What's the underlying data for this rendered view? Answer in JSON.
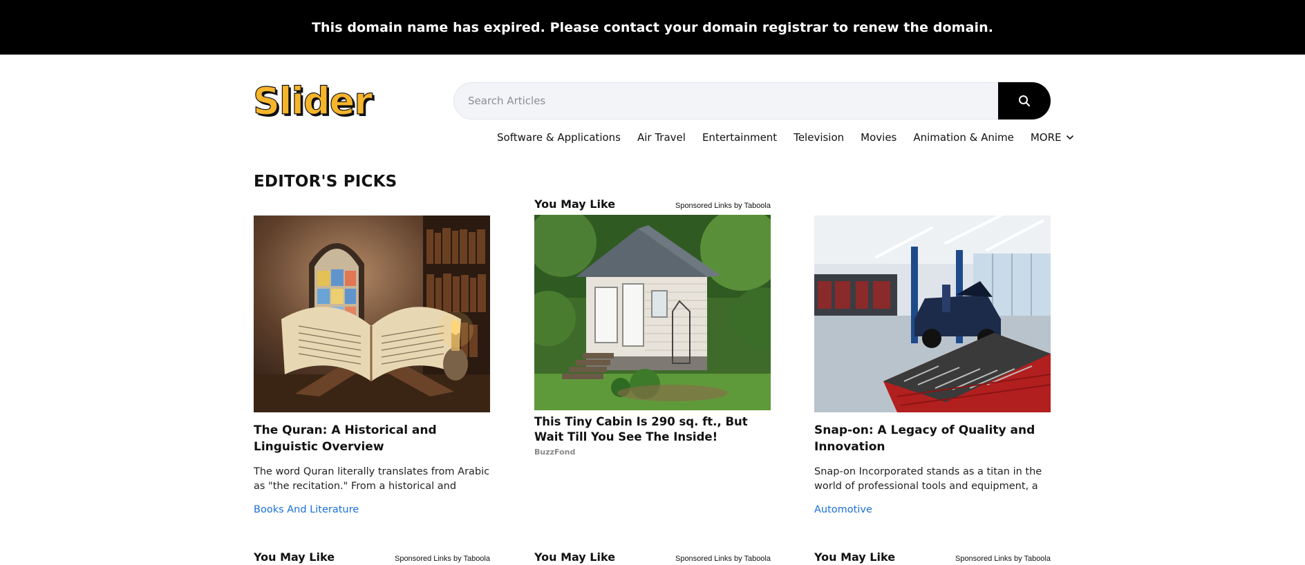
{
  "banner": {
    "text": "This domain name has expired. Please contact your domain registrar to renew the domain."
  },
  "logo": {
    "text": "Slider",
    "color": "#f7b52c"
  },
  "search": {
    "placeholder": "Search Articles",
    "value": "",
    "icon": "search-icon"
  },
  "nav": {
    "items": [
      "Software & Applications",
      "Air Travel",
      "Entertainment",
      "Television",
      "Movies",
      "Animation & Anime"
    ],
    "more_label": "MORE"
  },
  "editors_picks": {
    "heading": "EDITOR'S PICKS"
  },
  "cards": [
    {
      "title": "The Quran: A Historical and Linguistic Overview",
      "description": "The word Quran literally translates from Arabic as \"the recitation.\" From a historical and linguisti...",
      "category": "Books And Literature"
    },
    {
      "title": "Snap-on: A Legacy of Quality and Innovation",
      "description": "Snap-on Incorporated stands as a titan in the world of professional tools and equipment, a name syno...",
      "category": "Automotive"
    }
  ],
  "sponsored": {
    "heading": "You May Like",
    "attribution": "Sponsored Links by Taboola",
    "ad": {
      "title": "This Tiny Cabin Is 290 sq. ft., But Wait Till You See The Inside!",
      "source": "BuzzFond"
    }
  },
  "colors": {
    "link": "#1a6fd8",
    "banner_bg": "#000000",
    "accent": "#f7b52c"
  }
}
